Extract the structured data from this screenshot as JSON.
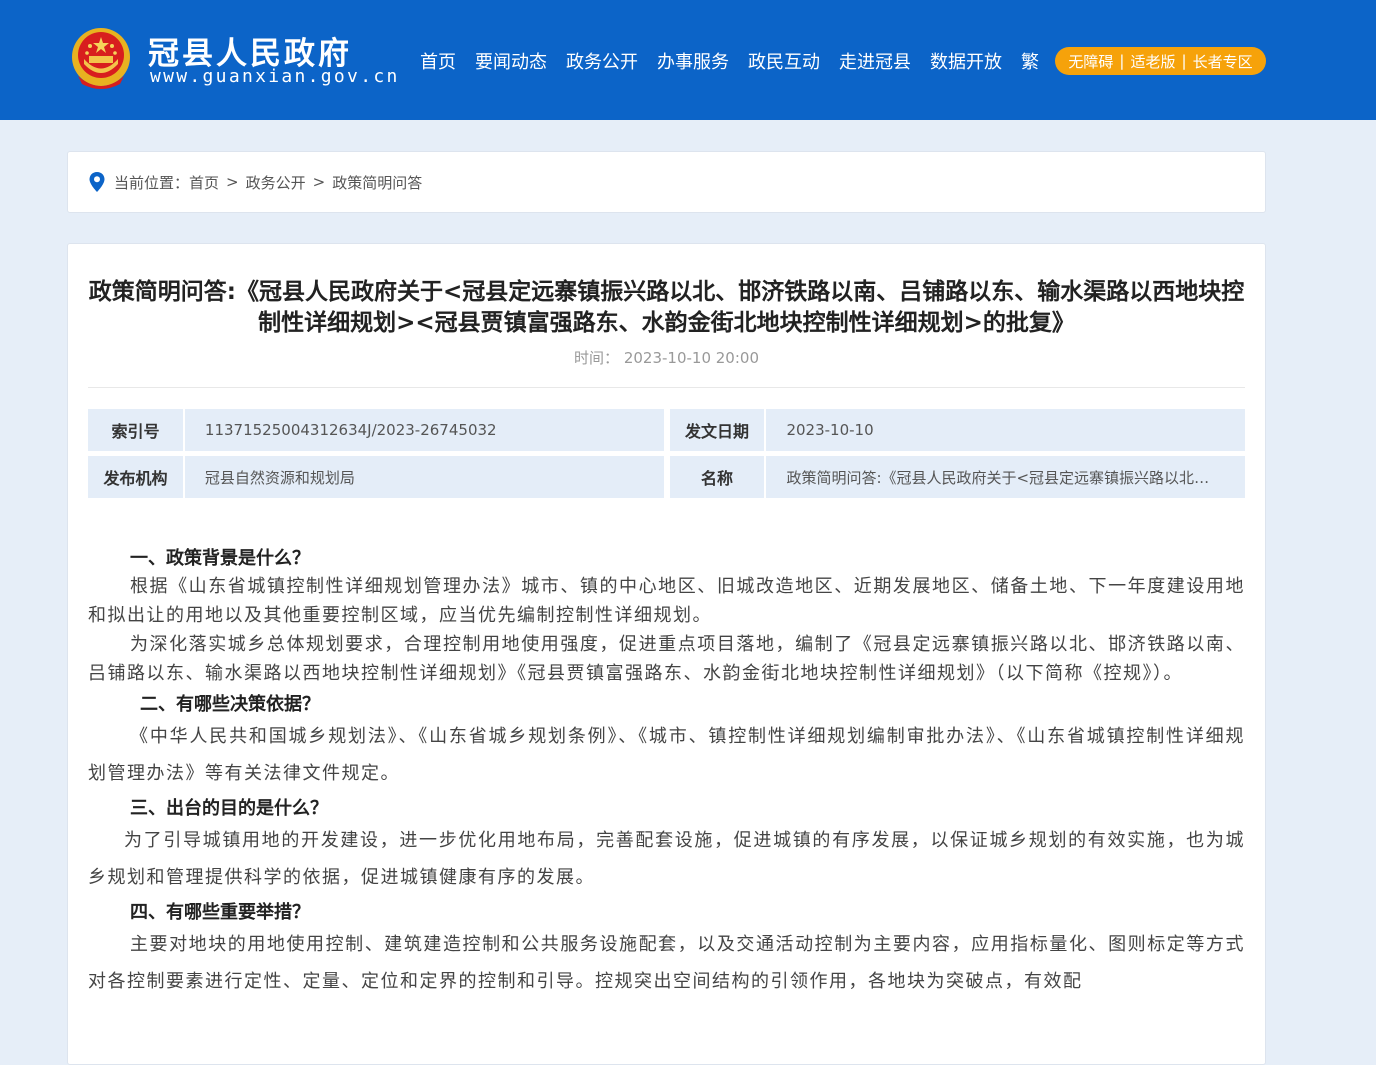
{
  "header": {
    "site_name": "冠县人民政府",
    "site_url": "www.guanxian.gov.cn",
    "nav": [
      "首页",
      "要闻动态",
      "政务公开",
      "办事服务",
      "政民互动",
      "走进冠县",
      "数据开放",
      "繁"
    ],
    "access": [
      "无障碍",
      "适老版",
      "长者专区"
    ],
    "colors": {
      "header_bg": "#0c64c8",
      "access_bg": "#f6a20a"
    }
  },
  "breadcrumb": {
    "prefix": "当前位置：",
    "items": [
      "首页",
      "政务公开",
      "政策简明问答"
    ],
    "icon": "location-pin-icon"
  },
  "article": {
    "title": "政策简明问答:《冠县人民政府关于<冠县定远寨镇振兴路以北、邯济铁路以南、吕铺路以东、输水渠路以西地块控制性详细规划><冠县贾镇富强路东、水韵金街北地块控制性详细规划>的批复》",
    "time_label": "时间：",
    "time_value": "2023-10-10 20:00",
    "meta": {
      "index_label": "索引号",
      "index_value": "11371525004312634J/2023-26745032",
      "date_label": "发文日期",
      "date_value": "2023-10-10",
      "org_label": "发布机构",
      "org_value": "冠县自然资源和规划局",
      "name_label": "名称",
      "name_value": "政策简明问答:《冠县人民政府关于<冠县定远寨镇振兴路以北、邯济铁路以南、吕铺路以东、输水渠路以西地块控制性详细规划><冠县贾镇富强路东、水韵金街北地块控制性详细规划>的批复》"
    },
    "sections": {
      "h1": "一、政策背景是什么？",
      "p1a": "根据《山东省城镇控制性详细规划管理办法》城市、镇的中心地区、旧城改造地区、近期发展地区、储备土地、下一年度建设用地和拟出让的用地以及其他重要控制区域，应当优先编制控制性详细规划。",
      "p1b": "为深化落实城乡总体规划要求，合理控制用地使用强度，促进重点项目落地，编制了《冠县定远寨镇振兴路以北、邯济铁路以南、吕铺路以东、输水渠路以西地块控制性详细规划》《冠县贾镇富强路东、水韵金街北地块控制性详细规划》（以下简称《控规》）。",
      "h2": "二、有哪些决策依据？",
      "p2": "《中华人民共和国城乡规划法》、《山东省城乡规划条例》、《城市、镇控制性详细规划编制审批办法》、《山东省城镇控制性详细规划管理办法》等有关法律文件规定。",
      "h3": "三、出台的目的是什么？",
      "p3": "为了引导城镇用地的开发建设，进一步优化用地布局，完善配套设施，促进城镇的有序发展，以保证城乡规划的有效实施，也为城乡规划和管理提供科学的依据，促进城镇健康有序的发展。",
      "h4": "四、有哪些重要举措？",
      "p4": "主要对地块的用地使用控制、建筑建造控制和公共服务设施配套，以及交通活动控制为主要内容，应用指标量化、图则标定等方式对各控制要素进行定性、定量、定位和定界的控制和引导。控规突出空间结构的引领作用，各地块为突破点，有效配"
    }
  }
}
